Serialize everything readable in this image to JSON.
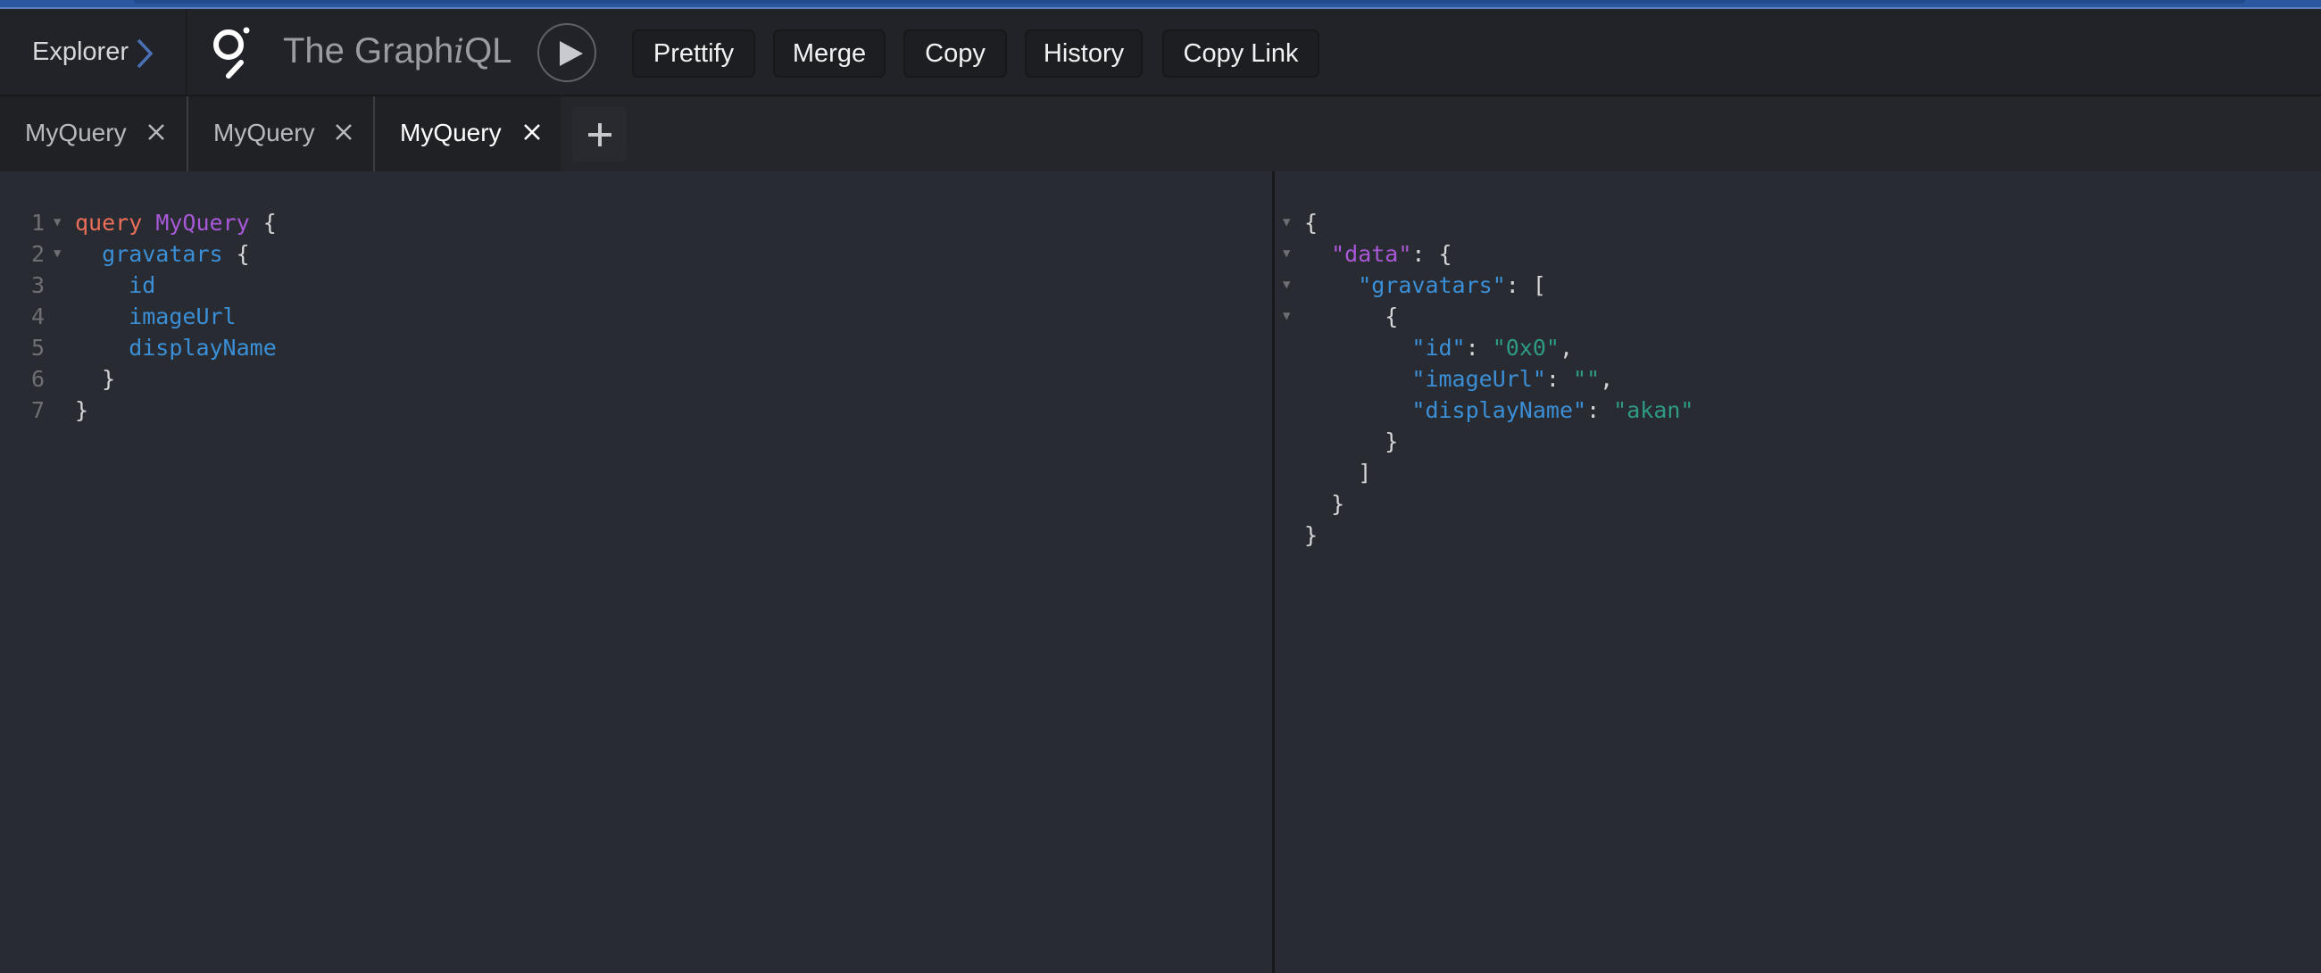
{
  "header": {
    "explorer_label": "Explorer",
    "logo_title_pre": "The Graph",
    "logo_title_i": "i",
    "logo_title_post": "QL",
    "run_button": "execute-query",
    "toolbar": [
      "Prettify",
      "Merge",
      "Copy",
      "History",
      "Copy Link"
    ]
  },
  "tabs": [
    {
      "label": "MyQuery",
      "active": false
    },
    {
      "label": "MyQuery",
      "active": false
    },
    {
      "label": "MyQuery",
      "active": true
    }
  ],
  "query_editor": {
    "line_numbers": [
      "1",
      "2",
      "3",
      "4",
      "5",
      "6",
      "7"
    ],
    "lines": [
      {
        "tokens": [
          [
            "kw",
            "query"
          ],
          [
            "punct",
            " "
          ],
          [
            "def",
            "MyQuery"
          ],
          [
            "punct",
            " {"
          ]
        ],
        "foldable": true,
        "indent": 0
      },
      {
        "tokens": [
          [
            "field",
            "gravatars"
          ],
          [
            "punct",
            " {"
          ]
        ],
        "foldable": true,
        "indent": 1
      },
      {
        "tokens": [
          [
            "field",
            "id"
          ]
        ],
        "foldable": false,
        "indent": 2
      },
      {
        "tokens": [
          [
            "field",
            "imageUrl"
          ]
        ],
        "foldable": false,
        "indent": 2
      },
      {
        "tokens": [
          [
            "field",
            "displayName"
          ]
        ],
        "foldable": false,
        "indent": 2
      },
      {
        "tokens": [
          [
            "punct",
            "}"
          ]
        ],
        "foldable": false,
        "indent": 1
      },
      {
        "tokens": [
          [
            "punct",
            "}"
          ]
        ],
        "foldable": false,
        "indent": 0
      }
    ]
  },
  "result_viewer": {
    "lines": [
      {
        "tokens": [
          [
            "punct",
            "{"
          ]
        ],
        "foldable": true,
        "indent": 0
      },
      {
        "tokens": [
          [
            "def",
            "\"data\""
          ],
          [
            "punct",
            ": {"
          ]
        ],
        "foldable": true,
        "indent": 1
      },
      {
        "tokens": [
          [
            "field",
            "\"gravatars\""
          ],
          [
            "punct",
            ": ["
          ]
        ],
        "foldable": true,
        "indent": 2
      },
      {
        "tokens": [
          [
            "punct",
            "{"
          ]
        ],
        "foldable": true,
        "indent": 3
      },
      {
        "tokens": [
          [
            "field",
            "\"id\""
          ],
          [
            "punct",
            ": "
          ],
          [
            "str",
            "\"0x0\""
          ],
          [
            "punct",
            ","
          ]
        ],
        "foldable": false,
        "indent": 4
      },
      {
        "tokens": [
          [
            "field",
            "\"imageUrl\""
          ],
          [
            "punct",
            ": "
          ],
          [
            "str",
            "\"\""
          ],
          [
            "punct",
            ","
          ]
        ],
        "foldable": false,
        "indent": 4
      },
      {
        "tokens": [
          [
            "field",
            "\"displayName\""
          ],
          [
            "punct",
            ": "
          ],
          [
            "str",
            "\"akan\""
          ]
        ],
        "foldable": false,
        "indent": 4
      },
      {
        "tokens": [
          [
            "punct",
            "}"
          ]
        ],
        "foldable": false,
        "indent": 3
      },
      {
        "tokens": [
          [
            "punct",
            "]"
          ]
        ],
        "foldable": false,
        "indent": 2
      },
      {
        "tokens": [
          [
            "punct",
            "}"
          ]
        ],
        "foldable": false,
        "indent": 1
      },
      {
        "tokens": [
          [
            "punct",
            "}"
          ]
        ],
        "foldable": false,
        "indent": 0
      }
    ]
  },
  "colors": {
    "keyword": "#eb6e59",
    "definition": "#a858d8",
    "field": "#3b8fd6",
    "string": "#2e9b84",
    "punctuation": "#d4d5d7",
    "accent_blue": "#2b57a0"
  }
}
